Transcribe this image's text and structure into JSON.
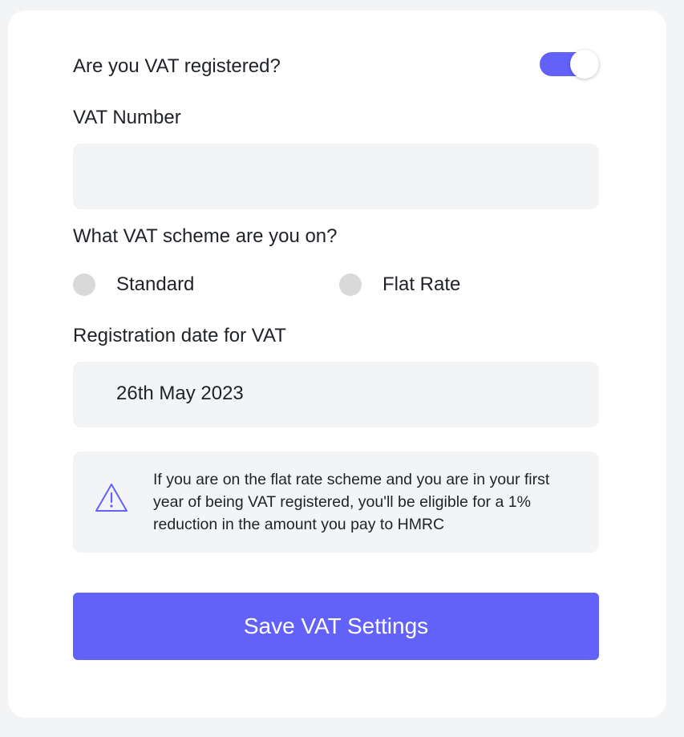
{
  "vat_form": {
    "registered_question": "Are you VAT registered?",
    "registered_toggle_on": true,
    "vat_number_label": "VAT Number",
    "vat_number_value": "",
    "vat_number_placeholder": "",
    "scheme_question": "What VAT scheme are you on?",
    "scheme_options": [
      {
        "label": "Standard",
        "selected": false
      },
      {
        "label": "Flat Rate",
        "selected": false
      }
    ],
    "registration_date_label": "Registration date for VAT",
    "registration_date_value": "26th May 2023",
    "info_icon": "warning-triangle-icon",
    "info_text": "If you are on the flat rate scheme and you are in your first year of being VAT registered, you'll be eligible for a 1% reduction in the amount you pay to HMRC",
    "save_button_label": "Save VAT Settings"
  },
  "colors": {
    "accent": "#6262fb",
    "page_background": "#f3f4f6",
    "card_background": "#ffffff",
    "field_background": "#f3f4f6",
    "radio_unselected": "#d9d9d9",
    "text": "#1f2328"
  }
}
